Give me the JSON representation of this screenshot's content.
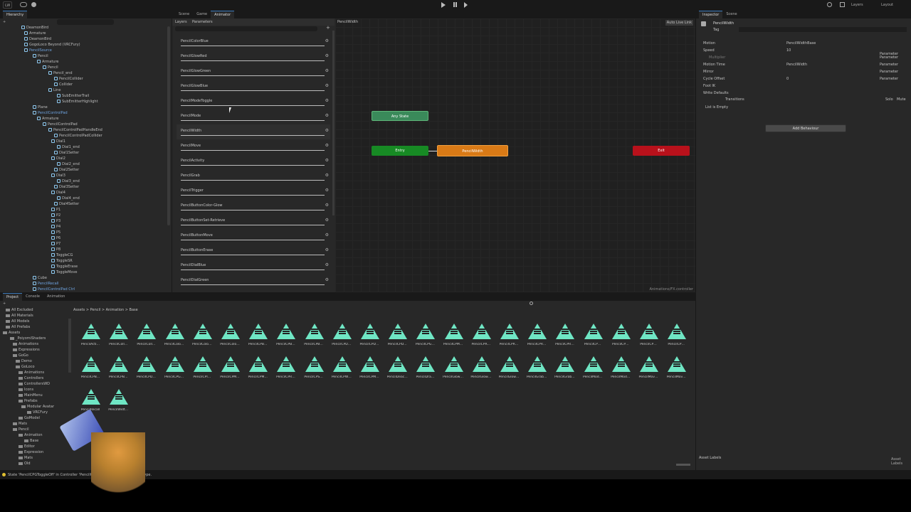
{
  "toolbar": {
    "account": "LW",
    "cloud_icon": "cloud-icon",
    "play_icon": "play-icon",
    "pause_icon": "pause-icon",
    "step_icon": "step-icon",
    "layers": "Layers",
    "layout": "Layout"
  },
  "hierarchy": {
    "tab": "Hierarchy",
    "items": [
      {
        "label": "DeamonBird"
      },
      {
        "label": "Armature"
      },
      {
        "label": "DeamonBird"
      },
      {
        "label": "GogoLoco Beyond (VRCFury)"
      },
      {
        "label": "PencilSource"
      },
      {
        "label": "Pencil"
      },
      {
        "label": "Armature"
      },
      {
        "label": "Pencil"
      },
      {
        "label": "Pencil_end"
      },
      {
        "label": "PencilCollider"
      },
      {
        "label": "Collider"
      },
      {
        "label": "Line"
      },
      {
        "label": "SubEmitterTrail"
      },
      {
        "label": "SubEmitterHighlight"
      },
      {
        "label": "Plane"
      },
      {
        "label": "PencilControlPad"
      },
      {
        "label": "Armature"
      },
      {
        "label": "PencilControlPad"
      },
      {
        "label": "PencilControlPadHandleEnd"
      },
      {
        "label": "PencilControlPadCollider"
      },
      {
        "label": "Dial1"
      },
      {
        "label": "Dial1_end"
      },
      {
        "label": "Dial1Setter"
      },
      {
        "label": "Dial2"
      },
      {
        "label": "Dial2_end"
      },
      {
        "label": "Dial2Setter"
      },
      {
        "label": "Dial3"
      },
      {
        "label": "Dial3_end"
      },
      {
        "label": "Dial3Setter"
      },
      {
        "label": "Dial4"
      },
      {
        "label": "Dial4_end"
      },
      {
        "label": "Dial4Setter"
      },
      {
        "label": "P1"
      },
      {
        "label": "P2"
      },
      {
        "label": "P3"
      },
      {
        "label": "P4"
      },
      {
        "label": "P5"
      },
      {
        "label": "P6"
      },
      {
        "label": "P7"
      },
      {
        "label": "P8"
      },
      {
        "label": "ToggleCG"
      },
      {
        "label": "ToggleSR"
      },
      {
        "label": "ToggleErase"
      },
      {
        "label": "ToggleMove"
      },
      {
        "label": "Cube"
      },
      {
        "label": "PencilRecall"
      },
      {
        "label": "PencilControlPad Ctrl"
      }
    ]
  },
  "animator": {
    "tabs": [
      "Scene",
      "Game",
      "Animator"
    ],
    "subtabs": [
      "Layers",
      "Parameters"
    ],
    "breadcrumb": "PencilWidth",
    "auto_live_link": "Auto Live Link",
    "params": [
      "PencilColorBlue",
      "PencilGlowRed",
      "PencilGlowGreen",
      "PencilGlowBlue",
      "PencilModeToggle",
      "PencilMode",
      "PencilWidth",
      "PencilMove",
      "PencilActivity",
      "PencilGrab",
      "PencilTrigger",
      "PencilButtonColor-Glow",
      "PencilButtonSet-Retrieve",
      "PencilButtonMove",
      "PencilButtonErase",
      "PencilDialBlue",
      "PencilDialGreen"
    ],
    "nodes": {
      "any_state": "Any State",
      "entry": "Entry",
      "state": "PencilWidth",
      "exit": "Exit"
    },
    "footer_path": "Animations/FX.controller"
  },
  "inspector": {
    "tabs": [
      "Inspector",
      "Scene"
    ],
    "title": "PencilWidth",
    "tag_label": "Tag",
    "fields": [
      {
        "label": "Motion",
        "value": "PencilWidthBase"
      },
      {
        "label": "Speed",
        "value": "10"
      },
      {
        "label": "Multiplier",
        "value": ""
      },
      {
        "label": "Motion Time",
        "value": "PencilWidth"
      },
      {
        "label": "Mirror",
        "value": ""
      },
      {
        "label": "Cycle Offset",
        "value": "0"
      },
      {
        "label": "Foot IK",
        "value": ""
      },
      {
        "label": "Write Defaults",
        "value": ""
      }
    ],
    "param_labels": [
      "Parameter",
      "Parameter",
      "Parameter",
      "Parameter",
      "Parameter"
    ],
    "transitions": "Transitions",
    "solo": "Solo",
    "mute": "Mute",
    "list_empty": "List is Empty",
    "add_behaviour": "Add Behaviour",
    "asset_labels": "Asset Labels"
  },
  "project": {
    "tabs": [
      "Project",
      "Console",
      "Animation"
    ],
    "breadcrumb": [
      "Assets",
      "Pencil",
      "Animation",
      "Base"
    ],
    "tree": [
      "All Excluded",
      "All Materials",
      "All Models",
      "All Prefabs",
      "Assets",
      "_PoiyomiShaders",
      "Animations",
      "Expressions",
      "GoGo",
      "Demo",
      "GoLoco",
      "Animations",
      "Controllers",
      "ControllersWD",
      "Icons",
      "MainMenu",
      "Prefabs",
      "Modular Avatar",
      "VRCFury",
      "GoModel",
      "Mats",
      "Pencil",
      "Animation",
      "Base",
      "Editor",
      "Expression",
      "Mats",
      "Old"
    ],
    "assets": [
      "PencilActi…",
      "PencilColl…",
      "PencilColl…",
      "PencilColo…",
      "PencilColo…",
      "PencilColo…",
      "PencilCPB…",
      "PencilCPB…",
      "PencilCPB…",
      "PencilCPD…",
      "PencilCPD…",
      "PencilCPD…",
      "PencilCPG…",
      "PencilCPM…",
      "PencilCPR…",
      "PencilCPR…",
      "PencilCPR…",
      "PencilCPR…",
      "PencilCP…",
      "PencilCP…",
      "PencilCP…",
      "PencilCP…",
      "PencilCPB…",
      "PencilCPB…",
      "PencilCPD…",
      "PencilCPG…",
      "PencilCPI…",
      "PencilCPM…",
      "PencilCPM…",
      "PencilCPR…",
      "PencilCPS…",
      "PencilCPW…",
      "PencilCPM…",
      "PencilDeac…",
      "PencilDra…",
      "PencilGlow…",
      "PencilGlow…",
      "PencilGlow…",
      "PencilGrab…",
      "PencilGrab…",
      "PencilMod…",
      "PencilMod…",
      "PencilMov…",
      "PencilMov…",
      "PencilRecall",
      "PencilWidt…"
    ]
  },
  "status": {
    "error": "State 'PencilCPGToggleOff' in Controller 'PencilCPGToggle' which is not float type."
  }
}
